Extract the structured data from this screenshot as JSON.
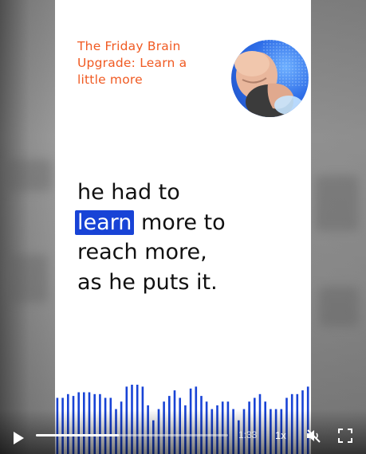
{
  "episode": {
    "title": "The Friday Brain Upgrade: Learn a little more"
  },
  "caption": {
    "before": "he had to",
    "highlight": "learn",
    "after_highlight": "more to",
    "line3": "reach more,",
    "line4": "as he puts it."
  },
  "player": {
    "time": "1:33",
    "speed": "1x",
    "progress": 0.43
  },
  "colors": {
    "accent": "#f05a22",
    "highlight": "#1843d6",
    "waveform": "#1843d6",
    "avatar_bg": "#2f6ee8"
  },
  "icons": {
    "play": "play-icon",
    "mute": "volume-muted-icon",
    "fullscreen": "fullscreen-icon"
  }
}
